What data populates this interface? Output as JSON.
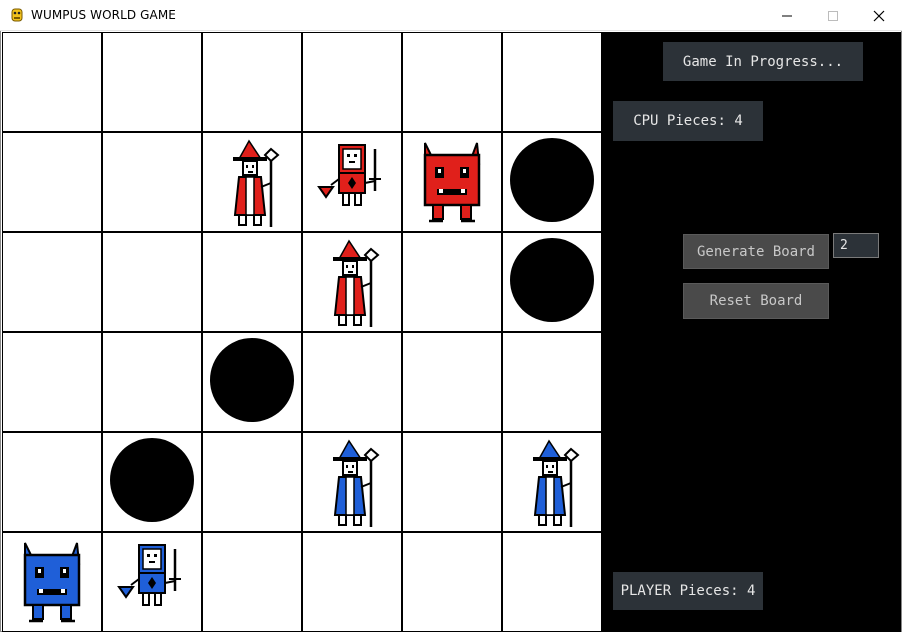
{
  "window": {
    "title": "WUMPUS WORLD GAME"
  },
  "board": {
    "rows": 6,
    "cols": 6,
    "pieces": [
      {
        "row": 1,
        "col": 2,
        "type": "wizard",
        "team": "cpu"
      },
      {
        "row": 1,
        "col": 3,
        "type": "knight",
        "team": "cpu"
      },
      {
        "row": 1,
        "col": 4,
        "type": "wumpus",
        "team": "cpu"
      },
      {
        "row": 1,
        "col": 5,
        "type": "pit"
      },
      {
        "row": 2,
        "col": 3,
        "type": "wizard",
        "team": "cpu"
      },
      {
        "row": 2,
        "col": 5,
        "type": "pit"
      },
      {
        "row": 3,
        "col": 2,
        "type": "pit"
      },
      {
        "row": 4,
        "col": 1,
        "type": "pit"
      },
      {
        "row": 4,
        "col": 3,
        "type": "wizard",
        "team": "player"
      },
      {
        "row": 4,
        "col": 5,
        "type": "wizard",
        "team": "player"
      },
      {
        "row": 5,
        "col": 0,
        "type": "wumpus",
        "team": "player"
      },
      {
        "row": 5,
        "col": 1,
        "type": "knight",
        "team": "player"
      }
    ]
  },
  "panel": {
    "status": "Game In Progress...",
    "cpu_pieces_label": "CPU Pieces: 4",
    "player_pieces_label": "PLAYER Pieces: 4",
    "generate_label": "Generate Board",
    "reset_label": "Reset Board",
    "count_value": "2"
  },
  "colors": {
    "cpu": "#e0201b",
    "player": "#1f5fd8",
    "pit": "#000000",
    "panel_bg": "#000000",
    "label_bg": "#2c3238"
  }
}
